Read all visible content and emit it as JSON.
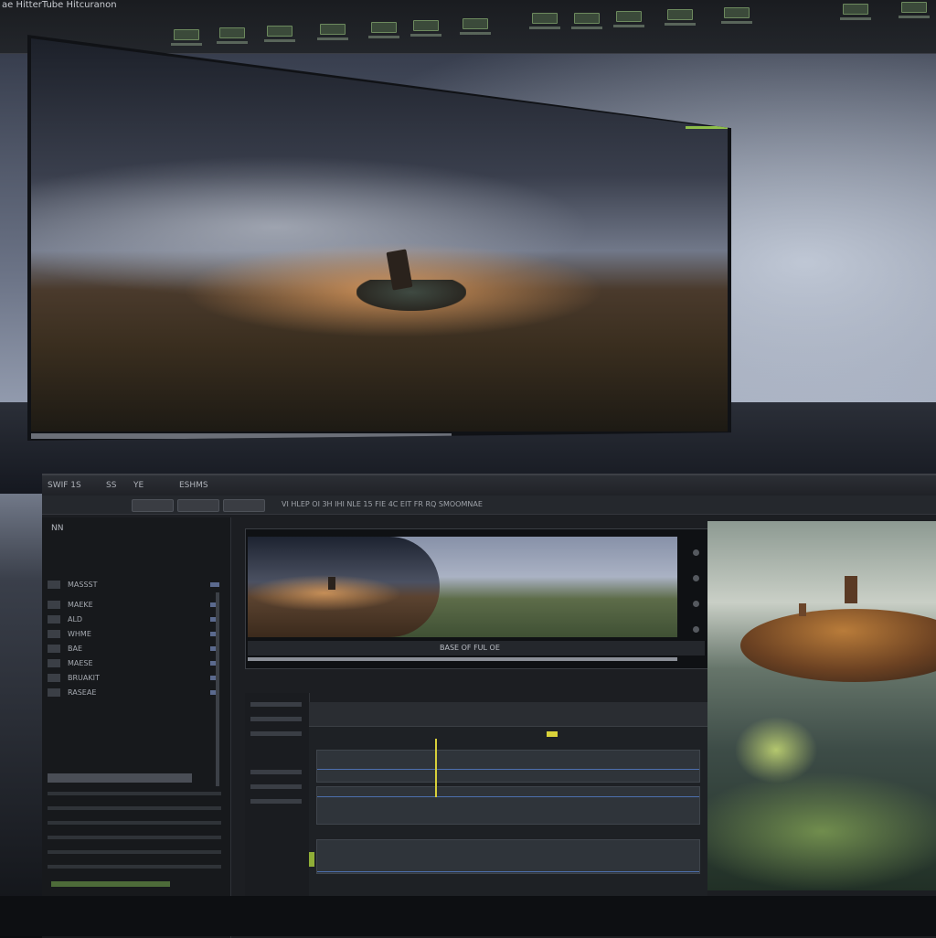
{
  "app": {
    "title": "ae HitterTube Hitcuranon"
  },
  "top_toolbar": {
    "tools": [
      {
        "icon": "clip-icon"
      },
      {
        "icon": "clip-icon"
      },
      {
        "icon": "clip-icon"
      },
      {
        "icon": "clip-icon"
      },
      {
        "icon": "clip-icon"
      },
      {
        "icon": "clip-icon"
      },
      {
        "icon": "clip-icon"
      },
      {
        "icon": "clip-icon"
      },
      {
        "icon": "clip-icon"
      },
      {
        "icon": "clip-icon"
      },
      {
        "icon": "clip-icon"
      },
      {
        "icon": "clip-icon"
      },
      {
        "icon": "clip-icon"
      },
      {
        "icon": "clip-icon"
      }
    ]
  },
  "editor": {
    "menu": [
      "SWIF 1S",
      "SS",
      "YE",
      "ESHMS"
    ],
    "toolbar_text": "VI HLEP   OI  3H  IHI NLE   15   FIE  4C  EIT FR  RQ SMOOMNAE"
  },
  "browser": {
    "title": "NN",
    "rows": [
      {
        "label": "MASSST"
      },
      {
        "label": "MAEKE"
      },
      {
        "label": "ALD"
      },
      {
        "label": "WHME"
      },
      {
        "label": "BAE"
      },
      {
        "label": "MAESE"
      },
      {
        "label": "BRUAKIT"
      },
      {
        "label": "RASEAE"
      }
    ]
  },
  "viewer": {
    "timecode": "BASE OF FUL OE"
  },
  "colors": {
    "accent_green": "#8fbf4a",
    "playhead_yellow": "#d7cf3a",
    "track_blue": "#4d6fae"
  }
}
